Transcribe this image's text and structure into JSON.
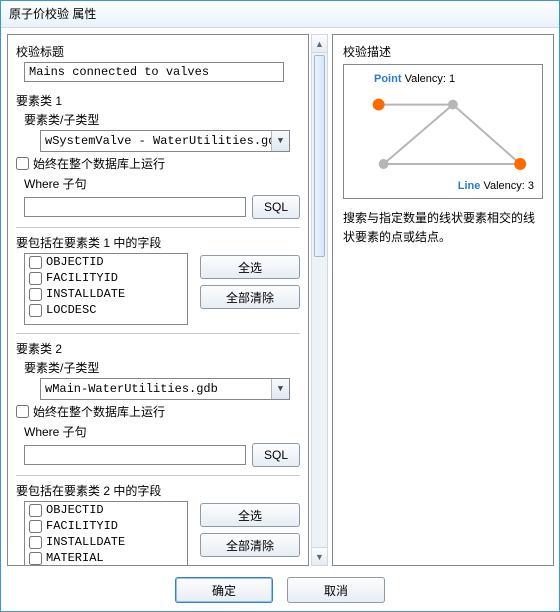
{
  "window": {
    "title": "原子价校验 属性"
  },
  "left": {
    "title_label": "校验标题",
    "title_value": "Mains connected to valves",
    "fc1": {
      "header": "要素类 1",
      "subtype_label": "要素类/子类型",
      "combo": "wSystemValve - WaterUtilities.gdb",
      "always_run": "始终在整个数据库上运行",
      "where_label": "Where 子句",
      "where_value": "",
      "sql_btn": "SQL",
      "fields_header": "要包括在要素类 1 中的字段",
      "fields": [
        "OBJECTID",
        "FACILITYID",
        "INSTALLDATE",
        "LOCDESC"
      ],
      "select_all": "全选",
      "clear_all": "全部清除"
    },
    "fc2": {
      "header": "要素类 2",
      "subtype_label": "要素类/子类型",
      "combo": "wMain-WaterUtilities.gdb",
      "always_run": "始终在整个数据库上运行",
      "where_label": "Where 子句",
      "where_value": "",
      "sql_btn": "SQL",
      "fields_header": "要包括在要素类 2 中的字段",
      "fields": [
        "OBJECTID",
        "FACILITYID",
        "INSTALLDATE",
        "MATERIAL"
      ],
      "select_all": "全选",
      "clear_all": "全部清除"
    }
  },
  "right": {
    "heading": "校验描述",
    "point_label": "Point",
    "point_valency": "Valency: 1",
    "line_label": "Line",
    "line_valency": "Valency: 3",
    "description": "搜索与指定数量的线状要素相交的线状要素的点或结点。"
  },
  "footer": {
    "ok": "确定",
    "cancel": "取消"
  }
}
